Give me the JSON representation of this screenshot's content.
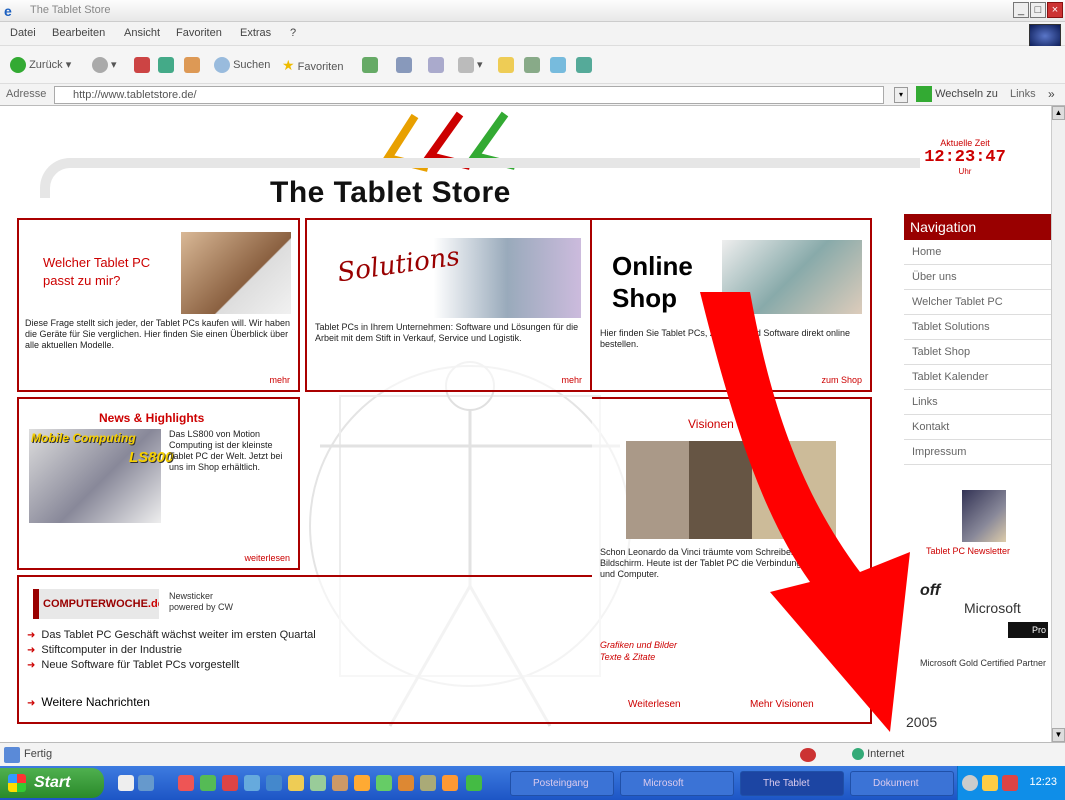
{
  "window": {
    "title": "The Tablet Store"
  },
  "menu": [
    "Datei",
    "Bearbeiten",
    "Ansicht",
    "Favoriten",
    "Extras",
    "?"
  ],
  "toolbar": {
    "back": "Zurück",
    "search": "Suchen",
    "favorites": "Favoriten"
  },
  "address": {
    "label": "Adresse",
    "url": "http://www.tabletstore.de/",
    "go": "Wechseln zu",
    "links": "Links"
  },
  "site": {
    "title": "The Tablet Store",
    "clock": {
      "label": "Aktuelle Zeit",
      "time": "12:23:47",
      "sub": "Uhr"
    }
  },
  "boxes": {
    "tabletpc": {
      "heading": "Welcher Tablet PC passt zu mir?",
      "text": "Diese Frage stellt sich jeder, der Tablet PCs kaufen will. Wir haben die Geräte für Sie verglichen. Hier finden Sie einen Überblick über alle aktuellen Modelle.",
      "more": "mehr"
    },
    "solutions": {
      "logo": "Solutions",
      "text": "Tablet PCs in Ihrem Unternehmen: Software und Lösungen für die Arbeit mit dem Stift in Verkauf, Service und Logistik.",
      "more": "mehr"
    },
    "shop": {
      "title_line1": "Online",
      "title_line2": "Shop",
      "text": "Hier finden Sie Tablet PCs, Zubehör und Software direkt online bestellen.",
      "more": "zum Shop"
    },
    "news": {
      "heading": "News & Highlights",
      "badge_line1": "Mobile Computing",
      "badge_line2": "LS800",
      "text": "Das LS800 von Motion Computing ist der kleinste Tablet PC der Welt. Jetzt bei uns im Shop erhältlich.",
      "more": "weiterlesen"
    },
    "vis": {
      "heading": "Visionen",
      "text": "Schon Leonardo da Vinci träumte vom Schreiben auf dem Bildschirm. Heute ist der Tablet PC die Verbindung von Papier und Computer.",
      "links": [
        "Grafiken und Bilder",
        "Texte & Zitate"
      ],
      "left_link": "Weiterlesen",
      "right_link": "Mehr Visionen"
    },
    "cw": {
      "logo": "COMPUTERWOCHE",
      "logo_suffix": ".de",
      "subtitle_line1": "Newsticker",
      "subtitle_line2": "powered by CW",
      "headlines": [
        "Das Tablet PC Geschäft wächst weiter im ersten Quartal",
        "Stiftcomputer in der Industrie",
        "Neue Software für Tablet PCs vorgestellt"
      ],
      "more": "Weitere Nachrichten"
    }
  },
  "nav": {
    "heading": "Navigation",
    "items": [
      "Home",
      "Über uns",
      "Welcher Tablet PC",
      "Tablet Solutions",
      "Tablet Shop",
      "Tablet Kalender",
      "Links",
      "Kontakt",
      "Impressum"
    ]
  },
  "sidebar": {
    "tablet_link": "Tablet PC Newsletter",
    "ms_logo": "Microsoft",
    "ms_badge": "Pro",
    "partner_text": "Microsoft Gold Certified Partner",
    "date": "2005"
  },
  "status": {
    "left": "Fertig",
    "zone": "Internet"
  },
  "taskbar": {
    "start": "Start",
    "tasks": [
      "Posteingang",
      "Microsoft",
      "The Tablet",
      "Dokument"
    ],
    "clock": "12:23"
  }
}
